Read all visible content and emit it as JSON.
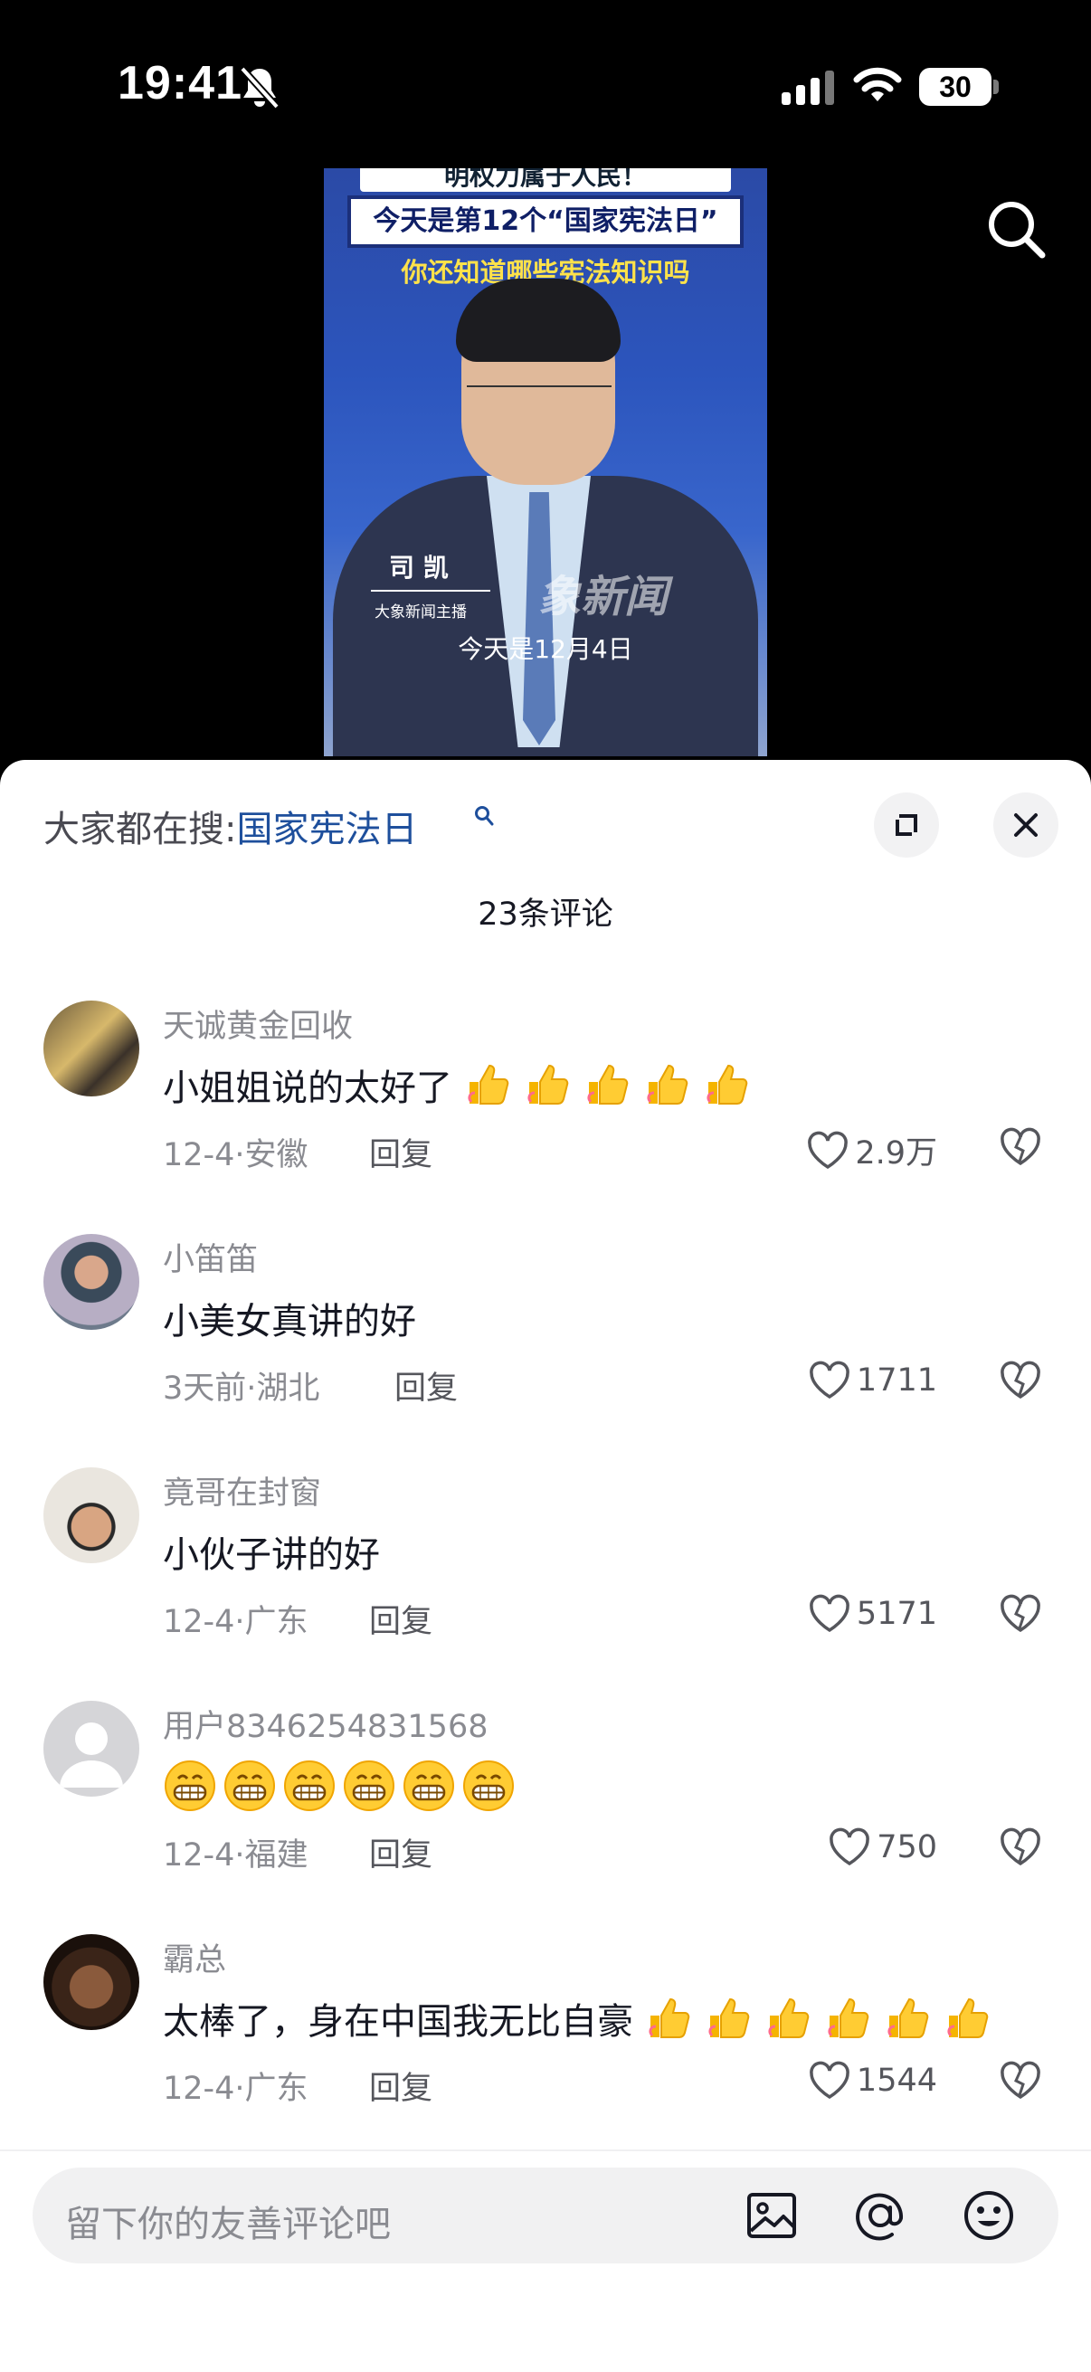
{
  "status": {
    "time": "19:41",
    "battery": "30"
  },
  "video": {
    "top_strip": "明权力属于人民！",
    "title_line1": "今天是第12个“国家宪法日”",
    "title_line2": "你还知道哪些宪法知识吗",
    "anchor_name": "司 凯",
    "anchor_role": "大象新闻主播",
    "logo": "象新闻",
    "subtitle": "今天是12月4日"
  },
  "sheet": {
    "hot_prefix": "大家都在搜:",
    "hot_keyword": "国家宪法日",
    "comment_count": "23条评论"
  },
  "comments": [
    {
      "user": "天诚黄金回收",
      "text": "小姐姐说的太好了",
      "thumbs": 5,
      "time_loc": "12-4·安徽",
      "reply": "回复",
      "likes": "2.9万"
    },
    {
      "user": "小笛笛",
      "text": "小美女真讲的好",
      "time_loc": "3天前·湖北",
      "reply": "回复",
      "likes": "1711"
    },
    {
      "user": "竟哥在封窗",
      "text": "小伙子讲的好",
      "time_loc": "12-4·广东",
      "reply": "回复",
      "likes": "5171"
    },
    {
      "user": "用户8346254831568",
      "text": "",
      "grins": 6,
      "time_loc": "12-4·福建",
      "reply": "回复",
      "likes": "750"
    },
    {
      "user": "霸总",
      "text": "太棒了，身在中国我无比自豪",
      "thumbs": 6,
      "time_loc": "12-4·广东",
      "reply": "回复",
      "likes": "1544"
    }
  ],
  "input": {
    "placeholder": "留下你的友善评论吧"
  },
  "colors": {
    "keyword": "#1e4f9c",
    "muted": "#8a8b91",
    "text": "#161823"
  },
  "icons": [
    "bell-slash-icon",
    "signal-icon",
    "wifi-icon",
    "search-icon",
    "expand-icon",
    "close-icon",
    "heart-icon",
    "broken-heart-icon",
    "image-icon",
    "at-icon",
    "emoji-icon",
    "thumbs-up-emoji",
    "grin-emoji"
  ]
}
